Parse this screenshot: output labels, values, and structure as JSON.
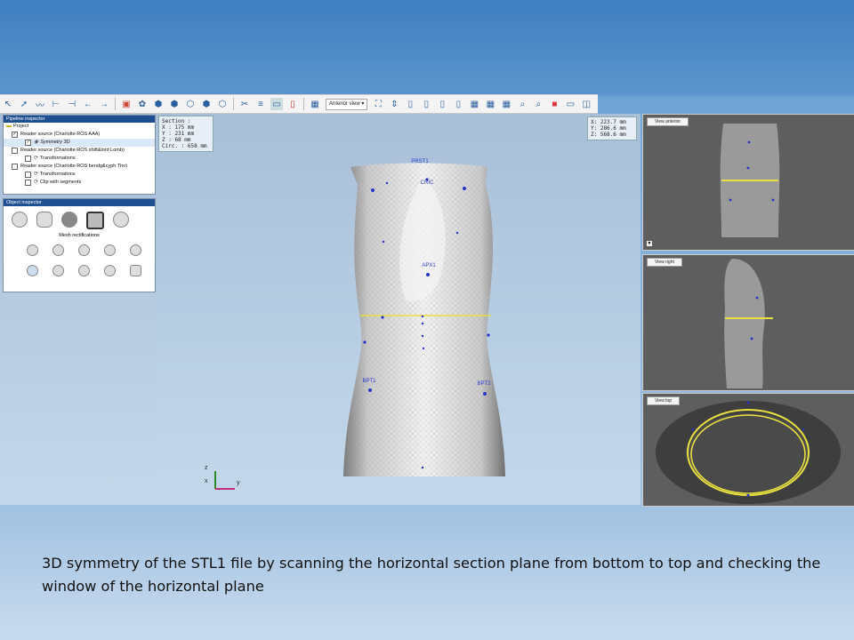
{
  "toolbar": {
    "view_select": "Anterior view",
    "icons": [
      "select-icon",
      "pointer-icon",
      "curve-icon",
      "measure-icon",
      "measure2-icon",
      "undo-icon",
      "redo-icon",
      "layer-icon",
      "render-icon",
      "cube1-icon",
      "cube2-icon",
      "cube3-icon",
      "cube4-icon",
      "cube5-icon",
      "cut-icon",
      "align-icon",
      "plane-icon",
      "probe-icon"
    ]
  },
  "pipeline": {
    "title": "Pipeline inspector",
    "items": [
      {
        "label": "Project",
        "checked": null
      },
      {
        "label": "Reader source (Charlotte ROS AAA)",
        "checked": true
      },
      {
        "label": "Symmetry 3D",
        "checked": true
      },
      {
        "label": "Reader source (Charlotte ROS shift&lord Lomb)",
        "checked": false
      },
      {
        "label": "Transformations",
        "checked": false
      },
      {
        "label": "Reader source (Charlotte ROS bendg&cyph Tho)",
        "checked": false
      },
      {
        "label": "Transformations",
        "checked": false
      },
      {
        "label": "Clip with segments",
        "checked": false
      }
    ]
  },
  "object_inspector": {
    "title": "Object inspector",
    "section": "Mesh rectifications"
  },
  "section_info": {
    "title": "Section :",
    "x": "X : 175 mm",
    "y": "Y : 231 mm",
    "z": "Z : 68 mm",
    "circ": "Circ. : 658 mm"
  },
  "coords": {
    "x": "X: 223.7 mm",
    "y": "Y: 286.6 mm",
    "z": "Z: 568.6 mm"
  },
  "views": {
    "anterior": "View anterior",
    "right": "View right",
    "top": "View top"
  },
  "landmarks": {
    "cric": "CRIC",
    "apx": "APX1",
    "bpt1": "BPT1",
    "bpt2": "BPT2"
  },
  "axes": {
    "z": "z",
    "x": "x",
    "y": "y"
  },
  "caption": "3D symmetry of the STL1 file by scanning the horizontal section plane from bottom to top and checking the window of the horizontal plane",
  "colors": {
    "title_bar": "#1e4f91",
    "section_line": "#e8e040",
    "landmark": "#2633c2"
  }
}
